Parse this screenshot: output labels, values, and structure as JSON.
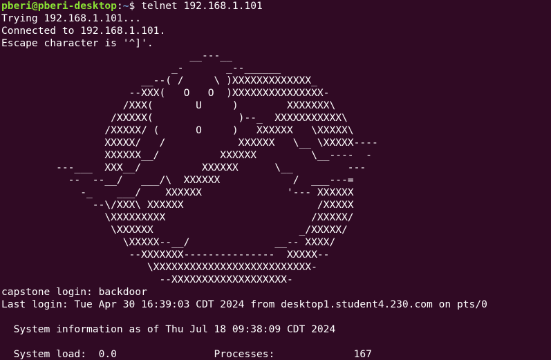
{
  "prompt": {
    "user_host": "pberi@pberi-desktop",
    "separator": ":",
    "path": "~",
    "symbol": "$ ",
    "command": "telnet 192.168.1.101"
  },
  "connection_lines": [
    "Trying 192.168.1.101...",
    "Connected to 192.168.1.101.",
    "Escape character is '^]'."
  ],
  "banner_lines": [
    "                               __---__",
    "                            _-       _--______",
    "                       __--( /     \\ )XXXXXXXXXXXXX_",
    "                     --XXX(   O   O  )XXXXXXXXXXXXXXX-",
    "                    /XXX(       U     )        XXXXXXX\\",
    "                  /XXXXX(              )--_  XXXXXXXXXXX\\",
    "                 /XXXXX/ (      O     )   XXXXXX   \\XXXXX\\",
    "                 XXXXX/   /            XXXXXX   \\__ \\XXXXX----",
    "                 XXXXXX__/          XXXXXX         \\__----  -",
    "         ---___  XXX__/          XXXXXX      \\__         ---",
    "           --  --__/   ___/\\  XXXXXX            /  ___---=",
    "             -_    ___/    XXXXXX              '--- XXXXXX",
    "               --\\/XXX\\ XXXXXX                      /XXXXX",
    "                 \\XXXXXXXXX                        /XXXXX/",
    "                  \\XXXXXX                        _/XXXXX/",
    "                    \\XXXXX--__/              __-- XXXX/",
    "                     --XXXXXXX---------------  XXXXX--",
    "                        \\XXXXXXXXXXXXXXXXXXXXXXXXXX-",
    "                          --XXXXXXXXXXXXXXXXXXX-"
  ],
  "login_lines": [
    "capstone login: backdoor",
    "Last login: Tue Apr 30 16:39:03 CDT 2024 from desktop1.student4.230.com on pts/0",
    "",
    "  System information as of Thu Jul 18 09:38:09 CDT 2024",
    "",
    "  System load:  0.0                Processes:             167"
  ],
  "colors": {
    "background": "#300a24",
    "text": "#ffffff",
    "prompt_user": "#8ae234",
    "prompt_path": "#729fcf"
  }
}
